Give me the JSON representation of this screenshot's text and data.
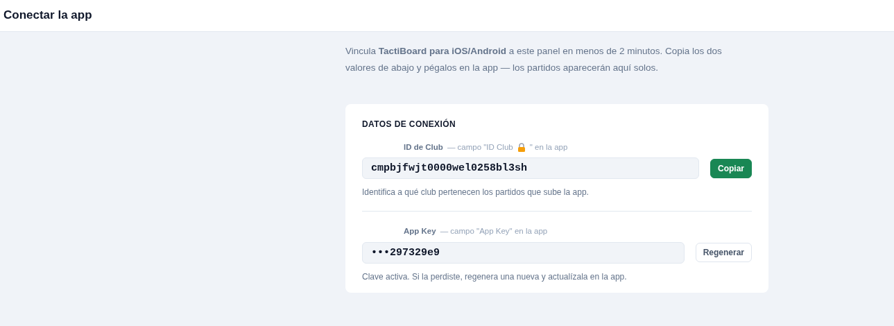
{
  "header": {
    "title": "Conectar la app"
  },
  "intro": "Vincula **TactiBoard para iOS/Android** a este panel en menos de 2 minutos. Copia los dos valores de abajo y pégalos en la app — los partidos aparecerán aquí solos.",
  "card": {
    "title": "DATOS DE CONEXIÓN",
    "fields": [
      {
        "label": "ID de Club",
        "hint": [
          {
            "kind": "text",
            "text": "— campo \"ID Club"
          },
          {
            "kind": "lock"
          },
          {
            "kind": "text",
            "text": "\" en la app"
          }
        ],
        "value": "cmpbjfwjt0000wel0258bl3sh",
        "button": {
          "label": "Copiar",
          "kind": "primary"
        },
        "help": "Identifica a qué club pertenecen los partidos que sube la app."
      },
      {
        "label": "App Key",
        "hint": [
          {
            "kind": "text",
            "text": "— campo \"App Key\" en la app"
          }
        ],
        "value": "•••297329e9",
        "button": {
          "label": "Regenerar",
          "kind": "secondary"
        },
        "help": "Clave activa. Si la perdiste, regenera una nueva y actualízala en la app."
      }
    ]
  }
}
